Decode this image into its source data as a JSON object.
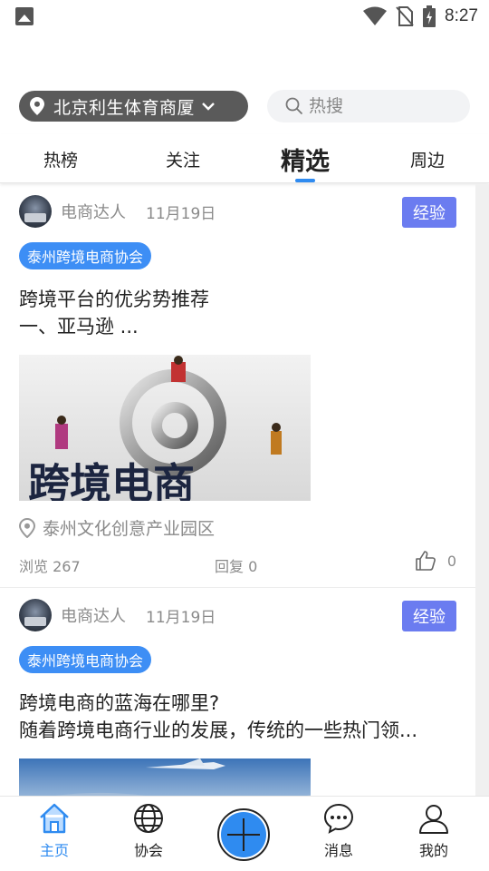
{
  "status_bar": {
    "time": "8:27",
    "icons": [
      "image-icon",
      "wifi-icon",
      "no-sim-icon",
      "battery-charging-icon"
    ]
  },
  "location": {
    "label": "北京利生体育商厦",
    "icon": "location-pin-icon"
  },
  "search": {
    "placeholder": "热搜"
  },
  "tabs": [
    {
      "label": "热榜",
      "active": false
    },
    {
      "label": "关注",
      "active": false
    },
    {
      "label": "精选",
      "active": true
    },
    {
      "label": "周边",
      "active": false
    }
  ],
  "accent_color": "#2f8bf0",
  "posts": [
    {
      "author": "电商达人",
      "date": "11月19日",
      "badge": "经验",
      "group": "泰州跨境电商协会",
      "title_line1": "跨境平台的优劣势推荐",
      "title_line2": "一、亚马逊 ...",
      "image_text": "跨境电商",
      "place": "泰州文化创意产业园区",
      "views": "浏览 267",
      "replies": "回复 0",
      "likes": "0"
    },
    {
      "author": "电商达人",
      "date": "11月19日",
      "badge": "经验",
      "group": "泰州跨境电商协会",
      "title_line1": "跨境电商的蓝海在哪里?",
      "title_line2": "随着跨境电商行业的发展，传统的一些热门领..."
    }
  ],
  "bottom_nav": [
    {
      "label": "主页",
      "icon": "home-icon",
      "active": true
    },
    {
      "label": "协会",
      "icon": "globe-icon",
      "active": false
    },
    {
      "label": "",
      "icon": "plus-icon",
      "active": false
    },
    {
      "label": "消息",
      "icon": "chat-bubble-icon",
      "active": false
    },
    {
      "label": "我的",
      "icon": "user-icon",
      "active": false
    }
  ]
}
